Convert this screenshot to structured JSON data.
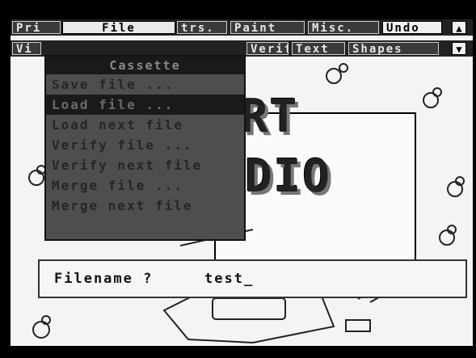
{
  "menu_top": {
    "items": [
      "Pri",
      "File",
      "trs.",
      "Paint",
      "Misc.",
      "Undo"
    ],
    "arrow_up": "▲"
  },
  "menu_bottom": {
    "items": [
      "Vi",
      "Verify",
      "Text",
      "Shapes"
    ],
    "arrow_down": "▼"
  },
  "dropdown": {
    "title": "Cassette",
    "items": [
      "Save file ...",
      "Load file ...",
      "Load next file",
      "Verify file ...",
      "Verify next file",
      "Merge file ...",
      "Merge next file"
    ],
    "highlighted_index": 1
  },
  "canvas": {
    "title_line1": "RT",
    "title_line2": "DIO"
  },
  "prompt": {
    "label": "Filename ?",
    "value": "test_"
  }
}
